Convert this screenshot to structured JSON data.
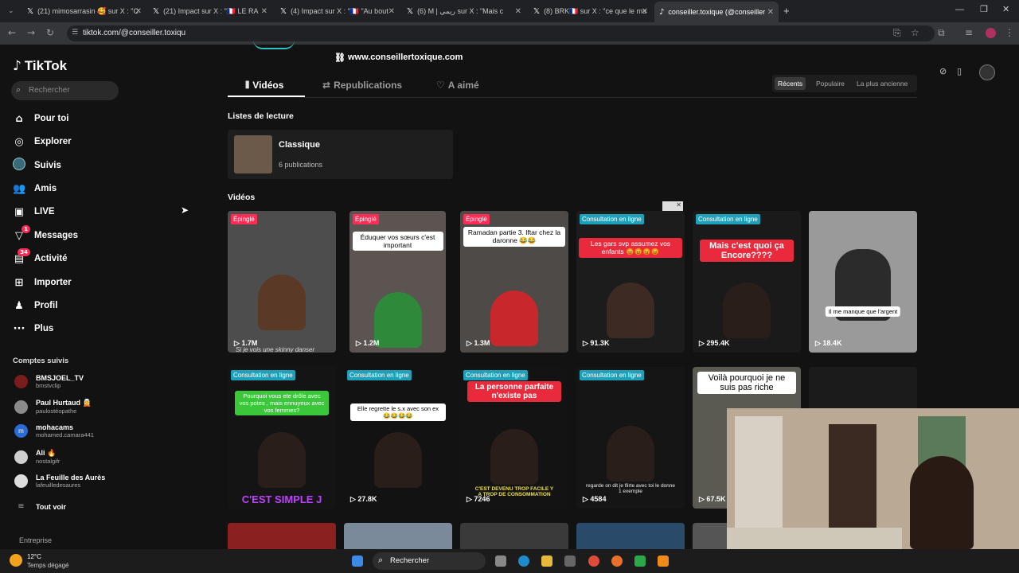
{
  "browser": {
    "tabs": [
      {
        "label": "(21) mimosarrasin 🥰 sur X : \"C"
      },
      {
        "label": "(21) Impact sur X : \"🇫🇷 LE RA"
      },
      {
        "label": "(4) Impact sur X : \"🇫🇷 \"Au bout"
      },
      {
        "label": "(6) M | ريمي sur X : \"Mais c"
      },
      {
        "label": "(8) BRK🇫🇷 sur X : \"ce que le ma"
      },
      {
        "label": "conseiller.toxique (@conseiller"
      }
    ],
    "url": "tiktok.com/@conseiller.toxiqu"
  },
  "sidebar": {
    "logo": "TikTok",
    "search_placeholder": "Rechercher",
    "nav": [
      {
        "label": "Pour toi",
        "icon": "home-icon"
      },
      {
        "label": "Explorer",
        "icon": "compass-icon"
      },
      {
        "label": "Suivis",
        "icon": "following-avatar-icon"
      },
      {
        "label": "Amis",
        "icon": "friends-icon"
      },
      {
        "label": "LIVE",
        "icon": "live-icon"
      },
      {
        "label": "Messages",
        "icon": "messages-icon",
        "badge": "1"
      },
      {
        "label": "Activité",
        "icon": "activity-icon",
        "badge": "34"
      },
      {
        "label": "Importer",
        "icon": "upload-icon"
      },
      {
        "label": "Profil",
        "icon": "profile-icon"
      },
      {
        "label": "Plus",
        "icon": "more-icon"
      }
    ],
    "following_title": "Comptes suivis",
    "accounts": [
      {
        "name": "BMSJOEL_TV",
        "handle": "bmstvclip"
      },
      {
        "name": "Paul Hurtaud 🧝",
        "handle": "paulostéopathe"
      },
      {
        "name": "mohacams",
        "handle": "mohamed.camara441"
      },
      {
        "name": "Ali 🔥",
        "handle": "nostalgifr"
      },
      {
        "name": "La Feuille des Aurès",
        "handle": "lafeuilledesaures"
      }
    ],
    "see_all": "Tout voir",
    "footer": "Entreprise"
  },
  "profile": {
    "link": "www.conseillertoxique.com",
    "tabs": [
      "Vidéos",
      "Republications",
      "A aimé"
    ],
    "sort": [
      "Récents",
      "Populaire",
      "La plus ancienne"
    ],
    "playlists_title": "Listes de lecture",
    "playlist": {
      "title": "Classique",
      "count": "6 publications"
    },
    "videos_title": "Vidéos"
  },
  "videos_row1": [
    {
      "tag": "Épinglé",
      "tag_type": "pin",
      "caption": "",
      "views": "1.7M",
      "sub": "Si je vois une skinny danser"
    },
    {
      "tag": "Épinglé",
      "tag_type": "pin",
      "caption": "Éduquer vos sœurs c'est important",
      "views": "1.2M"
    },
    {
      "tag": "Épinglé",
      "tag_type": "pin",
      "caption": "Ramadan partie 3. Iftar chez la daronne 😂😂",
      "views": "1.3M"
    },
    {
      "tag": "Consultation en ligne",
      "tag_type": "cons",
      "caption": "Les gars svp assumez vos enfants 😡😡😡😡",
      "views": "91.3K"
    },
    {
      "tag": "Consultation en ligne",
      "tag_type": "cons",
      "caption": "Mais c'est quoi ça Encore????",
      "views": "295.4K"
    },
    {
      "tag": "",
      "tag_type": "",
      "caption": "Il me manque que l'argent",
      "views": "18.4K"
    }
  ],
  "videos_row2": [
    {
      "tag": "Consultation en ligne",
      "caption": "Pourquoi vous ete drôle avec vos potes , mais ennuyeux avec vos femmes?",
      "views": "",
      "bottom": "C'EST SIMPLE J"
    },
    {
      "tag": "Consultation en ligne",
      "caption": "Elle regrette le s.x avec son ex 😂😂😂😂",
      "views": "27.8K"
    },
    {
      "tag": "Consultation en ligne",
      "caption": "La personne parfaite n'existe pas",
      "views": "7246",
      "bottom": "C'EST DEVENU TROP FACILE Y A TROP DE CONSOMMATION"
    },
    {
      "tag": "Consultation en ligne",
      "caption": "",
      "views": "4584",
      "bottom": "regarde on dit je flirte avec toi le donne 1 exemple"
    },
    {
      "tag": "",
      "caption": "Voilà pourquoi je ne suis pas riche",
      "views": "67.5K"
    }
  ],
  "taskbar": {
    "weather_temp": "12°C",
    "weather_desc": "Temps dégagé",
    "search": "Rechercher"
  },
  "colors": {
    "accent": "#fe2c55",
    "teal": "#20a0b8",
    "bg": "#121212"
  }
}
